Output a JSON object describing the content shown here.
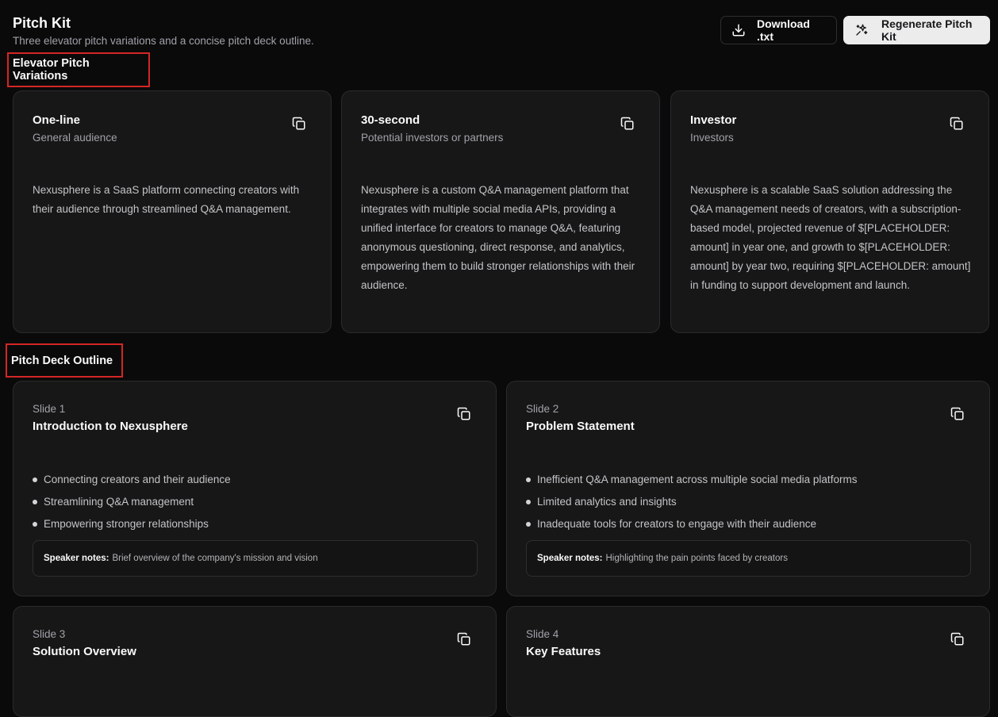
{
  "header": {
    "title": "Pitch Kit",
    "subtitle": "Three elevator pitch variations and a concise pitch deck outline.",
    "download_label": "Download .txt",
    "regenerate_label": "Regenerate Pitch Kit"
  },
  "sections": {
    "elevator_title": "Elevator Pitch Variations",
    "deck_title": "Pitch Deck Outline"
  },
  "pitches": [
    {
      "title": "One-line",
      "audience": "General audience",
      "text": "Nexusphere is a SaaS platform connecting creators with their audience through streamlined Q&A management."
    },
    {
      "title": "30-second",
      "audience": "Potential investors or partners",
      "text": "Nexusphere is a custom Q&A management platform that integrates with multiple social media APIs, providing a unified interface for creators to manage Q&A, featuring anonymous questioning, direct response, and analytics, empowering them to build stronger relationships with their audience."
    },
    {
      "title": "Investor",
      "audience": "Investors",
      "text": "Nexusphere is a scalable SaaS solution addressing the Q&A management needs of creators, with a subscription-based model, projected revenue of $[PLACEHOLDER: amount] in year one, and growth to $[PLACEHOLDER: amount] by year two, requiring $[PLACEHOLDER: amount] in funding to support development and launch."
    }
  ],
  "slides": [
    {
      "number": "Slide 1",
      "title": "Introduction to Nexusphere",
      "bullets": [
        "Connecting creators and their audience",
        "Streamlining Q&A management",
        "Empowering stronger relationships"
      ],
      "notes_label": "Speaker notes:",
      "notes": "Brief overview of the company's mission and vision"
    },
    {
      "number": "Slide 2",
      "title": "Problem Statement",
      "bullets": [
        "Inefficient Q&A management across multiple social media platforms",
        "Limited analytics and insights",
        "Inadequate tools for creators to engage with their audience"
      ],
      "notes_label": "Speaker notes:",
      "notes": "Highlighting the pain points faced by creators"
    },
    {
      "number": "Slide 3",
      "title": "Solution Overview"
    },
    {
      "number": "Slide 4",
      "title": "Key Features"
    }
  ],
  "icons": {
    "download": "download-icon",
    "regenerate": "sparkles-icon",
    "copy": "copy-icon"
  },
  "colors": {
    "background": "#0a0a0a",
    "card": "#171717",
    "section_highlight": "#d42626"
  }
}
